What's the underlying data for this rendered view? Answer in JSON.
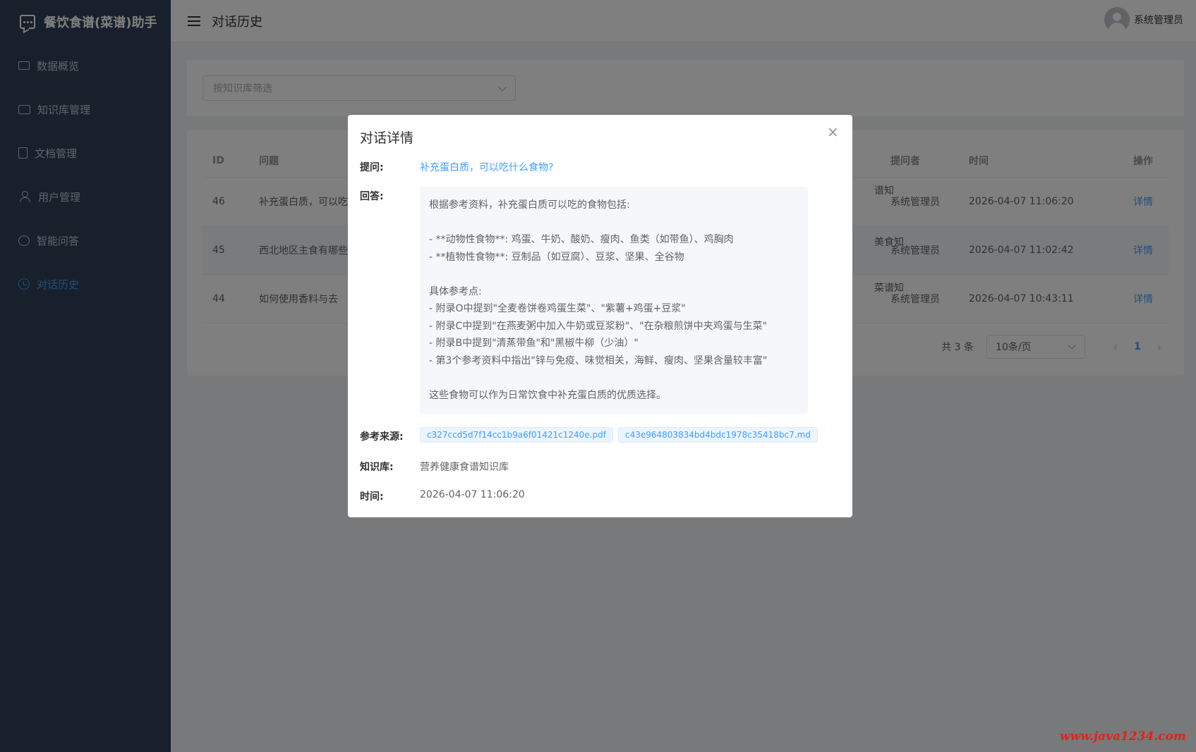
{
  "app": {
    "title": "餐饮食谱(菜谱)助手"
  },
  "sidebar": {
    "items": [
      {
        "label": "数据概览",
        "icon": "monitor-icon"
      },
      {
        "label": "知识库管理",
        "icon": "folder-icon"
      },
      {
        "label": "文档管理",
        "icon": "document-icon"
      },
      {
        "label": "用户管理",
        "icon": "user-icon"
      },
      {
        "label": "智能问答",
        "icon": "chat-icon"
      },
      {
        "label": "对话历史",
        "icon": "clock-icon",
        "active": true
      }
    ]
  },
  "header": {
    "title": "对话历史",
    "user": "系统管理员"
  },
  "filter": {
    "placeholder": "按知识库筛选"
  },
  "table": {
    "headers": {
      "id": "ID",
      "question": "问题",
      "asker": "提问者",
      "time": "时间",
      "op": "操作"
    },
    "rows": [
      {
        "id": "46",
        "question": "补充蛋白质，可以吃",
        "kb": "谱知",
        "asker": "系统管理员",
        "time": "2026-04-07 11:06:20",
        "op": "详情"
      },
      {
        "id": "45",
        "question": "西北地区主食有哪些",
        "kb": "美食知",
        "asker": "系统管理员",
        "time": "2026-04-07 11:02:42",
        "op": "详情"
      },
      {
        "id": "44",
        "question": "如何使用香料与去",
        "kb": "菜谱知",
        "asker": "系统管理员",
        "time": "2026-04-07 10:43:11",
        "op": "详情"
      }
    ]
  },
  "pager": {
    "total": "共 3 条",
    "size": "10条/页",
    "prev": "‹",
    "page": "1",
    "next": "›"
  },
  "dialog": {
    "title": "对话详情",
    "close": "×",
    "labels": {
      "question": "提问:",
      "answer": "回答:",
      "sources": "参考来源:",
      "kb": "知识库:",
      "time": "时间:"
    },
    "question": "补充蛋白质，可以吃什么食物?",
    "answer_lines": [
      "根据参考资料，补充蛋白质可以吃的食物包括:",
      "",
      "- **动物性食物**: 鸡蛋、牛奶、酸奶、瘦肉、鱼类（如带鱼）、鸡胸肉",
      "- **植物性食物**: 豆制品（如豆腐）、豆浆、坚果、全谷物",
      "",
      "具体参考点:",
      "- 附录O中提到\"全麦卷饼卷鸡蛋生菜\"、\"紫薯+鸡蛋+豆浆\"",
      "- 附录C中提到\"在燕麦粥中加入牛奶或豆浆粉\"、\"在杂粮煎饼中夹鸡蛋与生菜\"",
      "- 附录B中提到\"清蒸带鱼\"和\"黑椒牛柳（少油）\"",
      "- 第3个参考资料中指出\"锌与免疫、味觉相关，海鲜、瘦肉、坚果含量较丰富\"",
      "",
      "这些食物可以作为日常饮食中补充蛋白质的优质选择。"
    ],
    "sources": [
      "c327ccd5d7f14cc1b9a6f01421c1240e.pdf",
      "c43e964803834bd4bdc1978c35418bc7.md"
    ],
    "kb": "营养健康食谱知识库",
    "time": "2026-04-07 11:06:20"
  },
  "watermark": "www.java1234.com",
  "colors": {
    "sidebar_bg": "#304156",
    "accent": "#409eff",
    "watermark": "#e0231a"
  }
}
